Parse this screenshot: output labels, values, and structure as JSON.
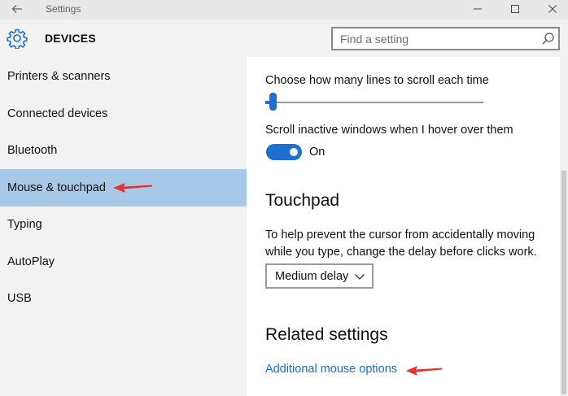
{
  "window": {
    "title": "Settings"
  },
  "header": {
    "title": "DEVICES",
    "search_placeholder": "Find a setting"
  },
  "sidebar": {
    "items": [
      {
        "label": "Printers & scanners",
        "selected": false
      },
      {
        "label": "Connected devices",
        "selected": false
      },
      {
        "label": "Bluetooth",
        "selected": false
      },
      {
        "label": "Mouse & touchpad",
        "selected": true
      },
      {
        "label": "Typing",
        "selected": false
      },
      {
        "label": "AutoPlay",
        "selected": false
      },
      {
        "label": "USB",
        "selected": false
      }
    ]
  },
  "main": {
    "scroll_lines_label": "Choose how many lines to scroll each time",
    "scroll_inactive_label": "Scroll inactive windows when I hover over them",
    "scroll_inactive_state": "On",
    "touchpad_heading": "Touchpad",
    "touchpad_description": "To help prevent the cursor from accidentally moving while you type, change the delay before clicks work.",
    "delay_select_value": "Medium delay",
    "related_heading": "Related settings",
    "additional_mouse_link": "Additional mouse options"
  },
  "colors": {
    "accent": "#1e6fd0",
    "selected_nav": "#a8c8e8",
    "link": "#1a6fc4",
    "annotation_arrow": "#e5302e"
  },
  "icons": {
    "back": "back-arrow-icon",
    "gear": "gear-icon",
    "search": "search-icon",
    "chevron": "chevron-down-icon"
  }
}
